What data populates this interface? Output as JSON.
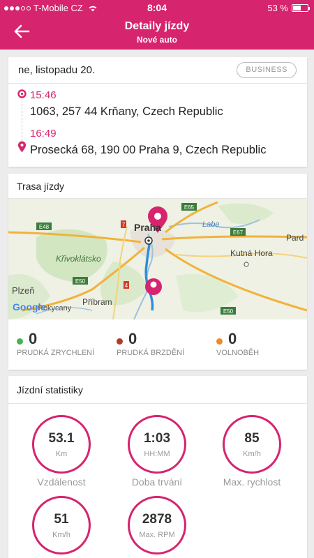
{
  "status_bar": {
    "carrier": "T-Mobile CZ",
    "time": "8:04",
    "battery": "53 %"
  },
  "header": {
    "title": "Detaily jízdy",
    "subtitle": "Nové auto"
  },
  "trip": {
    "date": "ne, listopadu 20.",
    "tag": "BUSINESS",
    "start_time": "15:46",
    "start_address": "1063, 257 44 Krňany, Czech Republic",
    "end_time": "16:49",
    "end_address": "Prosecká 68, 190 00 Praha 9, Czech Republic"
  },
  "route_card": {
    "title": "Trasa jízdy",
    "map_labels": {
      "praha": "Praha",
      "krivoklatsko": "Křivoklátsko",
      "kutna_hora": "Kutná Hora",
      "plzen": "Plzeň",
      "rokycany": "Rokycany",
      "pribram": "Příbram",
      "labe": "Labe",
      "pardubice": "Pard",
      "google": "Google",
      "e48": "E48",
      "e50a": "E50",
      "e50b": "E50",
      "e65": "E65",
      "e67": "E67",
      "r7": "7",
      "r4": "4"
    },
    "metrics": [
      {
        "value": "0",
        "label": "PRUDKÁ ZRYCHLENÍ",
        "color": "#4cb050"
      },
      {
        "value": "0",
        "label": "PRUDKÁ BRZDĚNÍ",
        "color": "#b23a2a"
      },
      {
        "value": "0",
        "label": "VOLNOBĚH",
        "color": "#ef8a2b"
      }
    ]
  },
  "stats_card": {
    "title": "Jízdní statistiky",
    "items": [
      {
        "value": "53.1",
        "unit": "Km",
        "label": "Vzdálenost"
      },
      {
        "value": "1:03",
        "unit": "HH:MM",
        "label": "Doba trvání"
      },
      {
        "value": "85",
        "unit": "Km/h",
        "label": "Max. rychlost"
      },
      {
        "value": "51",
        "unit": "Km/h",
        "label": ""
      },
      {
        "value": "2878",
        "unit": "Max. RPM",
        "label": ""
      }
    ]
  },
  "colors": {
    "accent": "#d6246e"
  }
}
